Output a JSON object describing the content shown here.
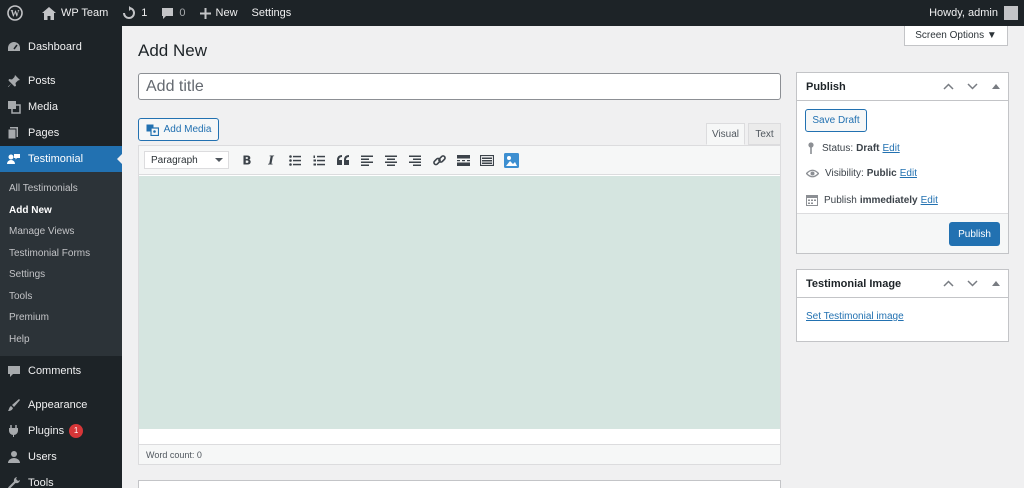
{
  "adminbar": {
    "site_name": "WP Team",
    "updates_count": "1",
    "comments_count": "0",
    "new_label": "New",
    "settings_label": "Settings",
    "howdy": "Howdy, admin"
  },
  "sidebar": {
    "dashboard": "Dashboard",
    "posts": "Posts",
    "media": "Media",
    "pages": "Pages",
    "testimonial": "Testimonial",
    "submenu": [
      "All Testimonials",
      "Add New",
      "Manage Views",
      "Testimonial Forms",
      "Settings",
      "Tools",
      "Premium",
      "Help"
    ],
    "comments": "Comments",
    "appearance": "Appearance",
    "plugins": "Plugins",
    "plugins_badge": "1",
    "users": "Users",
    "tools": "Tools"
  },
  "main": {
    "screen_options": "Screen Options ▼",
    "title": "Add New",
    "title_placeholder": "Add title",
    "add_media": "Add Media",
    "tab_visual": "Visual",
    "tab_text": "Text",
    "format_value": "Paragraph",
    "word_count": "Word count: 0"
  },
  "publish": {
    "header": "Publish",
    "save_draft": "Save Draft",
    "status_label": "Status:",
    "status_value": "Draft",
    "visibility_label": "Visibility:",
    "visibility_value": "Public",
    "publish_label": "Publish",
    "publish_value": "immediately",
    "edit": "Edit",
    "publish_button": "Publish"
  },
  "image_box": {
    "header": "Testimonial Image",
    "link": "Set Testimonial image"
  },
  "colors": {
    "accent": "#2271b1",
    "admin_dark": "#1d2327",
    "editor_bg": "#d5e5e0",
    "badge": "#d63638"
  }
}
